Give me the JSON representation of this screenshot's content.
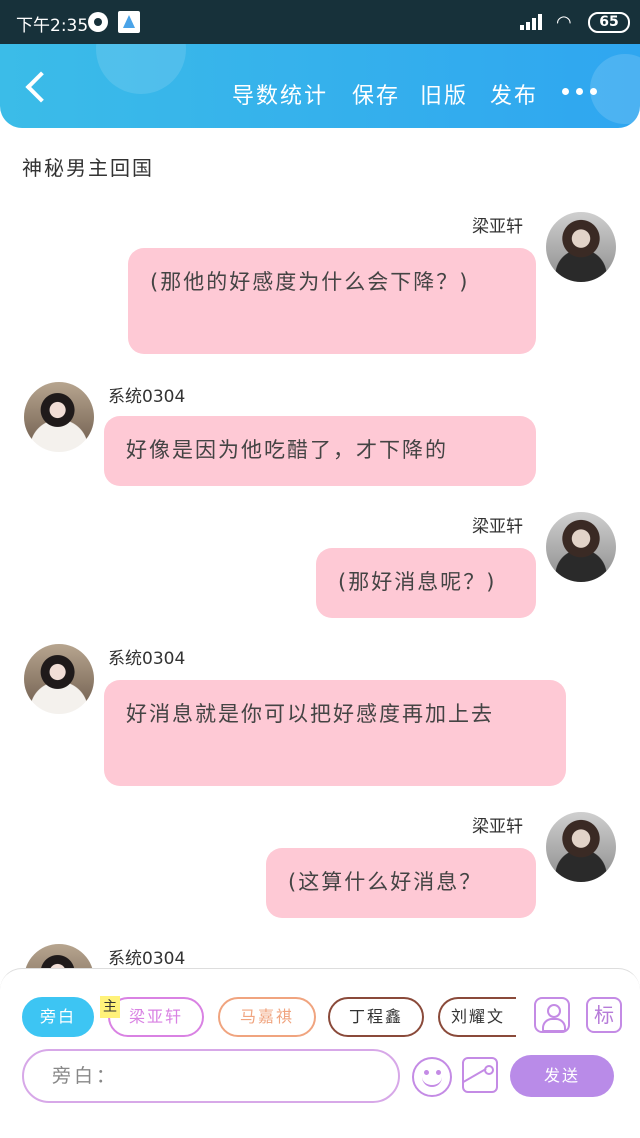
{
  "status_bar": {
    "time": "下午2:35",
    "battery": "65"
  },
  "header": {
    "actions": [
      "导数统计",
      "保存",
      "旧版",
      "发布"
    ]
  },
  "story_title": "神秘男主回国",
  "messages": [
    {
      "sender": "梁亚轩",
      "text": "(那他的好感度为什么会下降？)"
    },
    {
      "sender": "系统0304",
      "text": "好像是因为他吃醋了，才下降的"
    },
    {
      "sender": "梁亚轩",
      "text": "(那好消息呢？)"
    },
    {
      "sender": "系统0304",
      "text": "好消息就是你可以把好感度再加上去"
    },
    {
      "sender": "梁亚轩",
      "text": "(这算什么好消息？"
    },
    {
      "sender": "系统0304",
      "text": ""
    }
  ],
  "composer": {
    "characters": [
      "旁白",
      "梁亚轩",
      "马嘉祺",
      "丁程鑫",
      "刘耀文"
    ],
    "main_tag": "主",
    "tag_icon_label": "标",
    "input_placeholder": "旁白：",
    "send_label": "发送"
  }
}
